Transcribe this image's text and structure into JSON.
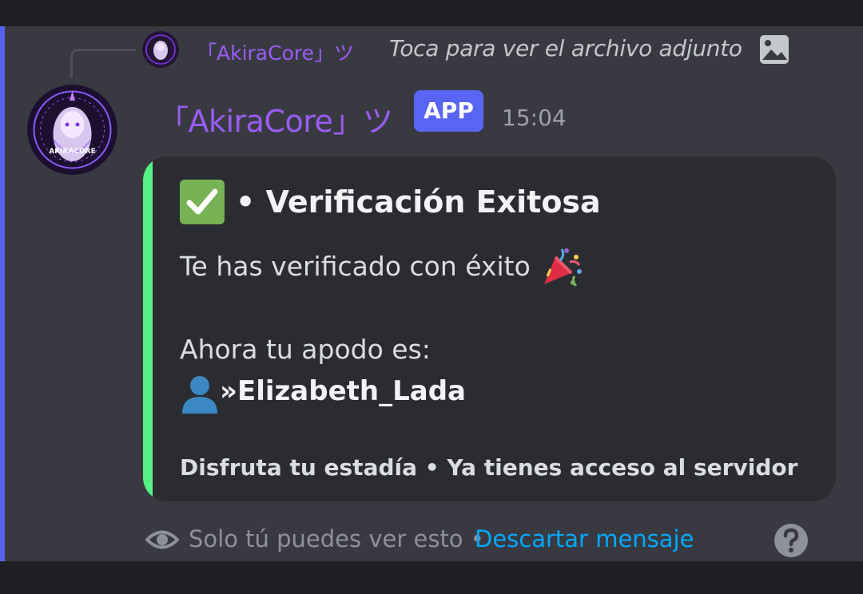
{
  "reply": {
    "author": "「AkiraCore」ツ",
    "text": "Toca para ver el archivo adjunto"
  },
  "message": {
    "author": "「AkiraCore」ツ",
    "badge": "APP",
    "timestamp": "15:04",
    "avatar_text": "AKIRACORE"
  },
  "embed": {
    "title": "• Verificación Exitosa",
    "line1": "Te has verificado con éxito",
    "line2": "Ahora tu apodo es:",
    "nickname": "»Elizabeth_Lada",
    "footer": "Disfruta tu estadía • Ya tienes acceso al servidor",
    "border_color": "#57f287"
  },
  "ephemeral": {
    "text": "Solo tú puedes ver esto •",
    "dismiss_label": "Descartar mensaje"
  },
  "icons": {
    "check": "check-mark-icon",
    "party": "party-popper-icon",
    "user": "user-silhouette-icon",
    "eye": "eye-icon",
    "help": "help-icon",
    "image": "image-icon"
  },
  "colors": {
    "username": "#9b5cf6",
    "badge": "#5865f2",
    "link": "#00a8fc",
    "accent": "#5865f2"
  }
}
